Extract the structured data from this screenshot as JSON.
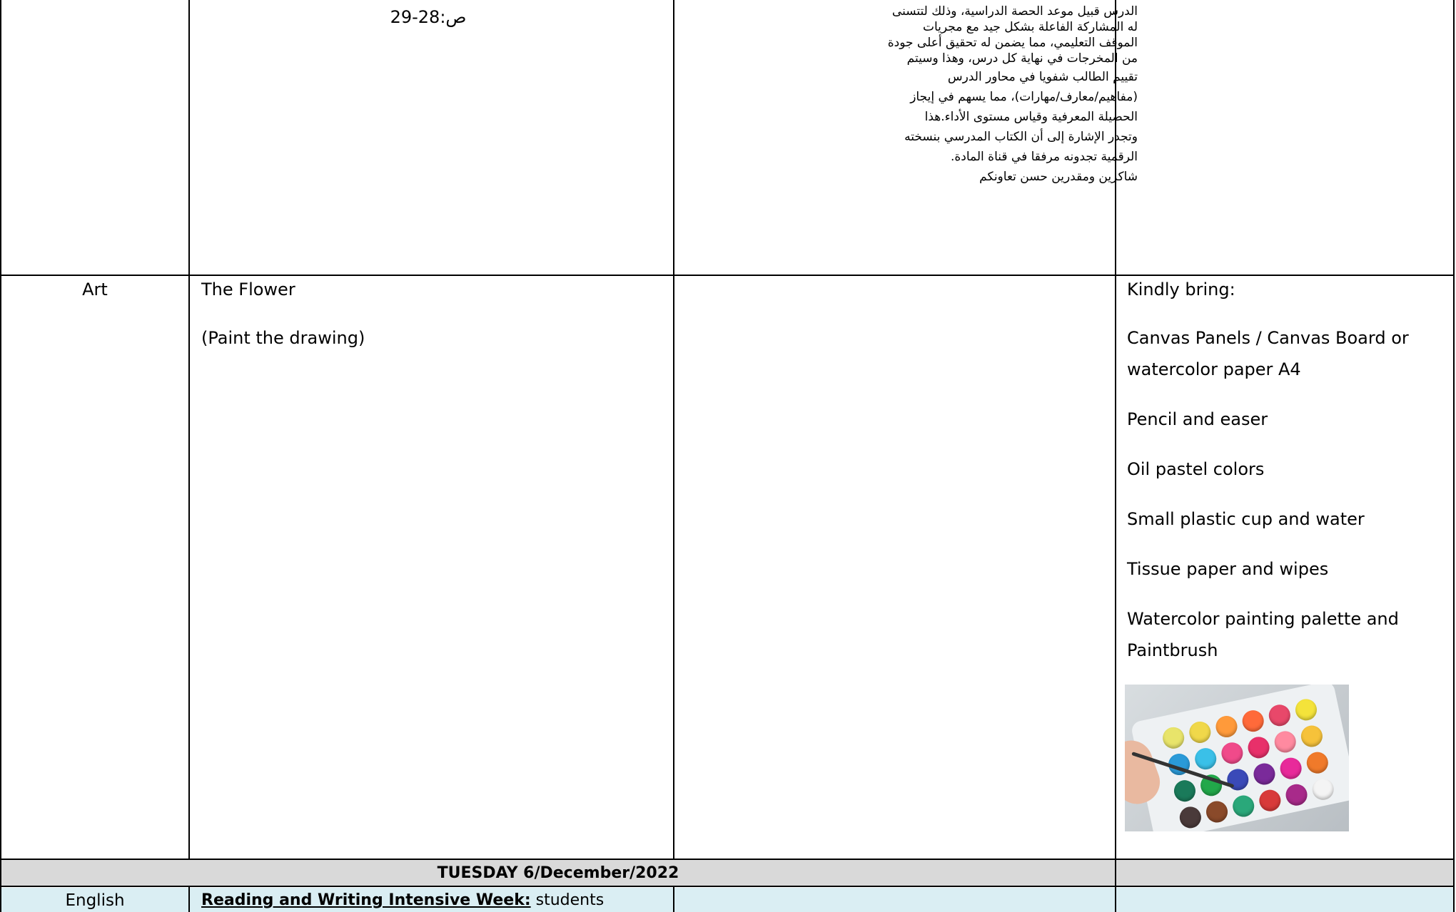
{
  "arabic_note": {
    "page_ref": "ص:28-29",
    "lines": [
      "الدرس قبيل موعد الحصة الدراسية، وذلك لتتسنى",
      "له المشاركة الفاعلة بشكل جيد مع مجريات",
      "الموقف التعليمي، مما يضمن له تحقيق أعلى جودة",
      "من المخرجات في نهاية كل درس، وهذا وسيتم",
      "تقييم الطالب شفويا في محاور الدرس",
      "(مفاهيم/معارف/مهارات)، مما يسهم في إيجاز",
      "الحصيلة المعرفية وقياس مستوى الأداء.هذا",
      "وتجدر الإشارة إلى أن الكتاب المدرسي بنسخته",
      "الرقمية تجدونه مرفقا في قناة المادة.",
      "شاكرين ومقدرين حسن تعاونكم"
    ]
  },
  "art_row": {
    "subject": "Art",
    "lesson_title": "The Flower",
    "lesson_note": "(Paint the drawing)",
    "materials_heading": "Kindly bring:",
    "materials": [
      [
        "Canvas Panels / Canvas Board or",
        "watercolor paper A4"
      ],
      [
        "Pencil and easer"
      ],
      [
        "Oil pastel colors"
      ],
      [
        "Small plastic cup and water"
      ],
      [
        "Tissue paper and wipes"
      ],
      [
        "Watercolor painting palette and",
        "Paintbrush"
      ]
    ],
    "image_icon": "watercolor-palette-photo"
  },
  "day_header": {
    "label": "TUESDAY 6/December/2022",
    "background": "#d9d9d9"
  },
  "english_row": {
    "subject": "English",
    "lesson_bold": "Reading and Writing Intensive Week:",
    "lesson_rest": " students",
    "background": "#daeef3"
  }
}
